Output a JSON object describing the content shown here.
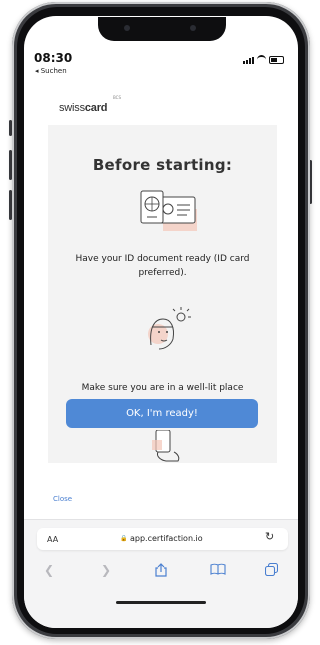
{
  "status_bar": {
    "time": "08:30",
    "back_label": "◂ Suchen"
  },
  "brand": {
    "logo_regular": "swiss",
    "logo_bold": "card",
    "logo_sup": "BCS"
  },
  "onboarding": {
    "title": "Before starting:",
    "step1": "Have your ID document ready (ID card preferred).",
    "step2": "Make sure you are in a well-lit place",
    "ok_button": "OK, I'm ready!"
  },
  "close_label": "Close",
  "browser": {
    "text_size_label": "AA",
    "url": "app.certifaction.io",
    "icons": [
      "back-icon",
      "forward-icon",
      "share-icon",
      "bookmarks-icon",
      "tabs-icon"
    ]
  },
  "colors": {
    "accent": "#4f89d6",
    "link": "#4a7fd0",
    "illustration": "#f4c6b8"
  }
}
